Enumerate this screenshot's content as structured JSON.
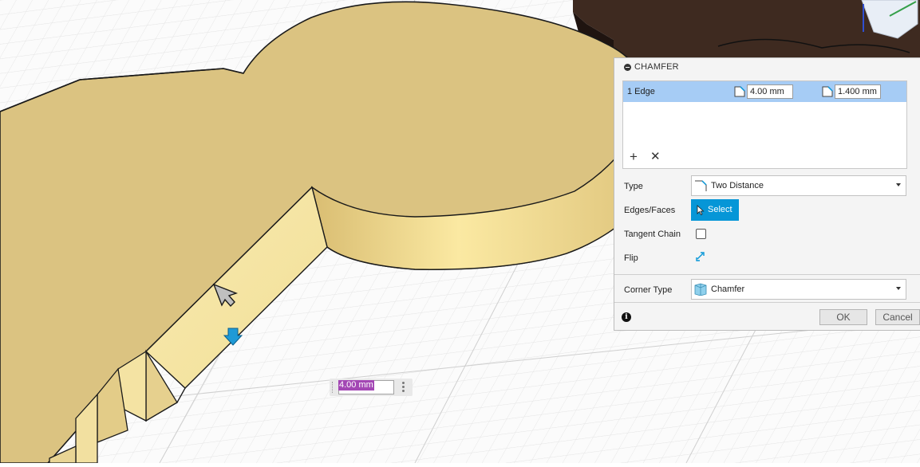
{
  "panel": {
    "title": "CHAMFER",
    "selection": {
      "edge_label": "1 Edge",
      "distance1": "4.00 mm",
      "distance2": "1.400 mm"
    },
    "rows": {
      "type_label": "Type",
      "type_value": "Two Distance",
      "edges_faces_label": "Edges/Faces",
      "select_button": "Select",
      "tangent_chain_label": "Tangent Chain",
      "tangent_chain_checked": false,
      "flip_label": "Flip",
      "corner_type_label": "Corner Type",
      "corner_type_value": "Chamfer"
    },
    "buttons": {
      "ok": "OK",
      "cancel": "Cancel"
    }
  },
  "viewport": {
    "floating_input_value": "4.00 mm"
  },
  "colors": {
    "accent": "#0696d7",
    "selection_row": "#a6ccf5",
    "body_face": "#dcc484",
    "highlight_face": "#f5e6a8",
    "input_highlight": "#a347b4"
  }
}
